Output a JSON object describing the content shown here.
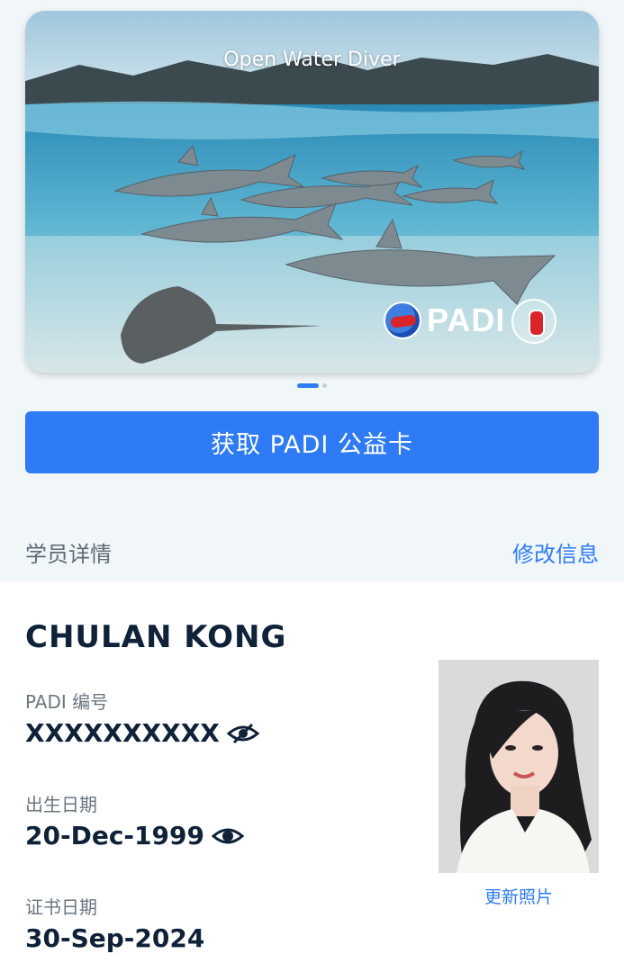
{
  "card": {
    "title": "Open Water Diver",
    "brand": "PADI",
    "logo_icon": "padi-globe-icon",
    "seal_icon": "aware-seal-icon"
  },
  "pager": {
    "count": 2,
    "active": 0
  },
  "cta": {
    "label": "获取 PADI 公益卡"
  },
  "section": {
    "title": "学员详情",
    "edit_label": "修改信息"
  },
  "student": {
    "name": "CHULAN KONG",
    "padi_id_label": "PADI 编号",
    "padi_id_value": "XXXXXXXXXX",
    "padi_id_icon": "eye-off-icon",
    "birth_label": "出生日期",
    "birth_value": "20-Dec-1999",
    "birth_icon": "eye-icon",
    "cert_label": "证书日期",
    "cert_value": "30-Sep-2024",
    "update_photo_label": "更新照片"
  },
  "colors": {
    "accent": "#2e7bf5",
    "text_dark": "#0f2238",
    "text_muted": "#6b7580",
    "page_bg": "#f1f6f9"
  }
}
